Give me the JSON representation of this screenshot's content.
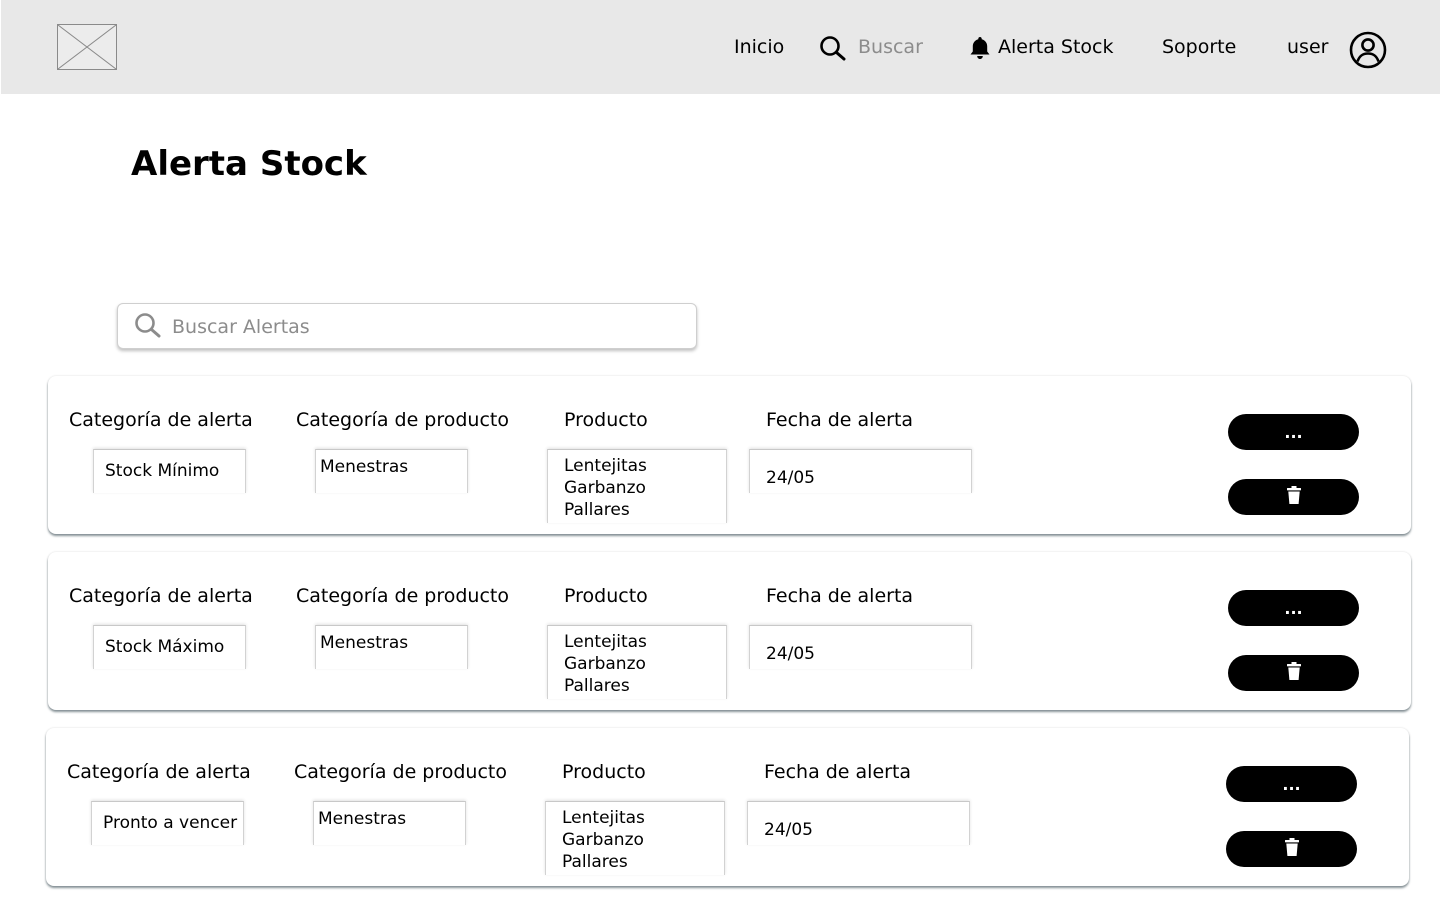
{
  "nav": {
    "inicio": "Inicio",
    "buscar": "Buscar",
    "alerta_stock": "Alerta Stock",
    "soporte": "Soporte",
    "user": "user"
  },
  "page": {
    "title": "Alerta Stock"
  },
  "search": {
    "placeholder": "Buscar Alertas",
    "value": ""
  },
  "columns": {
    "alert_category": "Categoría de alerta",
    "product_category": "Categoría de producto",
    "product": "Producto",
    "alert_date": "Fecha de alerta"
  },
  "alerts": [
    {
      "alert_category": "Stock Mínimo",
      "product_category": "Menestras",
      "products": [
        "Lentejitas",
        "Garbanzo",
        "Pallares"
      ],
      "date": "24/05",
      "more_label": "...",
      "delete_icon": "trash-icon"
    },
    {
      "alert_category": "Stock Máximo",
      "product_category": "Menestras",
      "products": [
        "Lentejitas",
        "Garbanzo",
        "Pallares"
      ],
      "date": "24/05",
      "more_label": "...",
      "delete_icon": "trash-icon"
    },
    {
      "alert_category": "Pronto a vencer",
      "product_category": "Menestras",
      "products": [
        "Lentejitas",
        "Garbanzo",
        "Pallares"
      ],
      "date": "24/05",
      "more_label": "...",
      "delete_icon": "trash-icon"
    }
  ],
  "icons": {
    "logo": "image-placeholder-icon",
    "search": "search-icon",
    "alerts": "bell-icon",
    "user": "user-circle-icon",
    "delete": "trash-icon"
  },
  "colors": {
    "header_bg": "#e8e8e8",
    "button_bg": "#000000",
    "placeholder_text": "#8c8c8c"
  }
}
